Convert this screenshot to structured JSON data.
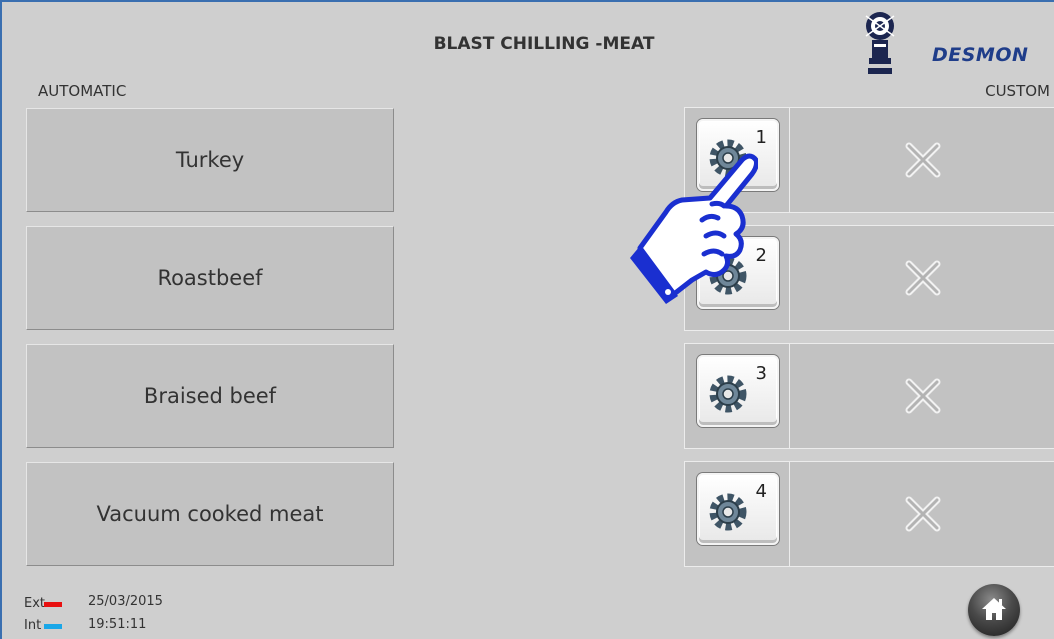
{
  "header": {
    "title": "BLAST CHILLING -MEAT",
    "brand": "DESMON"
  },
  "sections": {
    "automatic_label": "AUTOMATIC",
    "custom_label": "CUSTOM"
  },
  "automatic_recipes": [
    {
      "label": "Turkey"
    },
    {
      "label": "Roastbeef"
    },
    {
      "label": "Braised beef"
    },
    {
      "label": "Vacuum cooked meat"
    }
  ],
  "custom_programs": [
    {
      "number": "1",
      "icon": "gear-icon",
      "status_icon": "x-icon"
    },
    {
      "number": "2",
      "icon": "gear-icon",
      "status_icon": "x-icon"
    },
    {
      "number": "3",
      "icon": "gear-icon",
      "status_icon": "x-icon"
    },
    {
      "number": "4",
      "icon": "gear-icon",
      "status_icon": "x-icon"
    }
  ],
  "footer": {
    "ext_label": "Ext",
    "int_label": "Int",
    "date": "25/03/2015",
    "time": "19:51:11",
    "ext_color": "#e81010",
    "int_color": "#1aa7e8"
  },
  "colors": {
    "background": "#cfcfcf",
    "button": "#c2c2c2",
    "brand": "#1f3d8a",
    "pointer": "#1a2fd0"
  }
}
